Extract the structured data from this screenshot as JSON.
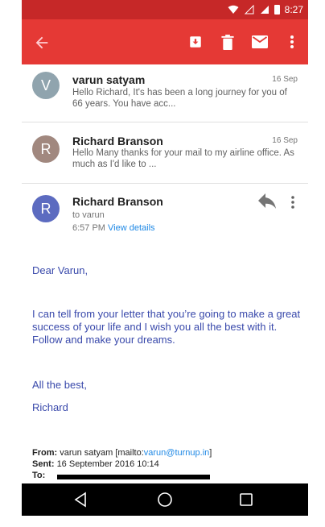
{
  "status_bar": {
    "time": "8:27"
  },
  "app_bar": {
    "icons": [
      "back-arrow-icon",
      "archive-icon",
      "delete-icon",
      "mail-icon",
      "more-vert-icon"
    ],
    "color": "#e53935"
  },
  "threads": [
    {
      "sender": "varun satyam",
      "date": "16 Sep",
      "snippet": "Hello Richard, It's has been a long journey for you of 66 years. You have acc...",
      "avatar_letter": "V",
      "avatar_color": "#90a4ae"
    },
    {
      "sender": "Richard Branson",
      "date": "16 Sep",
      "snippet": "Hello Many thanks for your mail to my airline office. As much as I'd like to ...",
      "avatar_letter": "R",
      "avatar_color": "#a1887f"
    }
  ],
  "open_message": {
    "avatar_letter": "R",
    "avatar_color": "#5c6bc0",
    "sender": "Richard Branson",
    "to": "to varun",
    "time": "6:57 PM",
    "view_details": "View details",
    "body": [
      "Dear Varun,",
      "I can tell from your letter that you’re going to make a great success of your life and I wish you all the best with it. Follow and make your dreams.",
      "All the best,",
      "Richard"
    ],
    "quoted": {
      "from_label": "From:",
      "from_value": "varun satyam [mailto:",
      "from_email": "varun@turnup.in",
      "from_close": "]",
      "sent_label": "Sent:",
      "sent_value": "16 September 2016 10:14",
      "to_label": "To:"
    }
  },
  "nav_bar": {
    "icons": [
      "back-triangle-icon",
      "home-circle-icon",
      "recents-square-icon"
    ]
  }
}
